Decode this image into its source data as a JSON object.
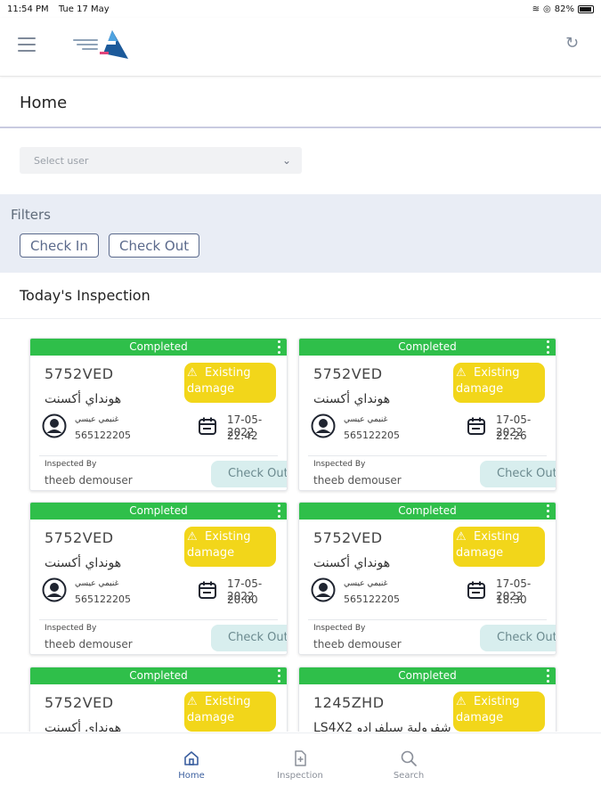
{
  "status_bar": {
    "time": "11:54 PM",
    "date": "Tue 17 May",
    "battery": "82%"
  },
  "page": {
    "title": "Home"
  },
  "select_user": {
    "placeholder": "Select user"
  },
  "filters": {
    "label": "Filters",
    "check_in": "Check In",
    "check_out": "Check Out"
  },
  "section": {
    "title": "Today's Inspection"
  },
  "colors": {
    "status_green": "#2fbf4a",
    "damage_yellow": "#f2d61a",
    "checkout_bg": "#d8eeee",
    "filters_bg": "#e9edf5",
    "accent": "#3b5f9f"
  },
  "cards": [
    {
      "status": "Completed",
      "plate": "5752VED",
      "model": "هونداي أكسنت",
      "damage": "Existing damage",
      "customer": "غنيمي عيسي",
      "phone": "565122205",
      "date": "17-05-2022",
      "time": "22:42",
      "inspected_by_label": "Inspected By",
      "inspector": "theeb demouser",
      "action": "Check Out"
    },
    {
      "status": "Completed",
      "plate": "5752VED",
      "model": "هونداي أكسنت",
      "damage": "Existing damage",
      "customer": "غنيمي عيسي",
      "phone": "565122205",
      "date": "17-05-2022",
      "time": "22:26",
      "inspected_by_label": "Inspected By",
      "inspector": "theeb demouser",
      "action": "Check Out"
    },
    {
      "status": "Completed",
      "plate": "5752VED",
      "model": "هونداي أكسنت",
      "damage": "Existing damage",
      "customer": "غنيمي عيسي",
      "phone": "565122205",
      "date": "17-05-2022",
      "time": "20:00",
      "inspected_by_label": "Inspected By",
      "inspector": "theeb demouser",
      "action": "Check Out"
    },
    {
      "status": "Completed",
      "plate": "5752VED",
      "model": "هونداي أكسنت",
      "damage": "Existing damage",
      "customer": "غنيمي عيسي",
      "phone": "565122205",
      "date": "17-05-2022",
      "time": "18:30",
      "inspected_by_label": "Inspected By",
      "inspector": "theeb demouser",
      "action": "Check Out"
    },
    {
      "status": "Completed",
      "plate": "5752VED",
      "model": "هونداي أكسنت",
      "damage": "Existing damage",
      "customer": "",
      "phone": "",
      "date": "",
      "time": "",
      "inspected_by_label": "",
      "inspector": "",
      "action": ""
    },
    {
      "status": "Completed",
      "plate": "1245ZHD",
      "model": "LS4X2 شفرولية سيلفرادو",
      "damage": "Existing damage",
      "customer": "",
      "phone": "",
      "date": "",
      "time": "",
      "inspected_by_label": "",
      "inspector": "",
      "action": ""
    }
  ],
  "nav": {
    "home": "Home",
    "inspection": "Inspection",
    "search": "Search"
  }
}
